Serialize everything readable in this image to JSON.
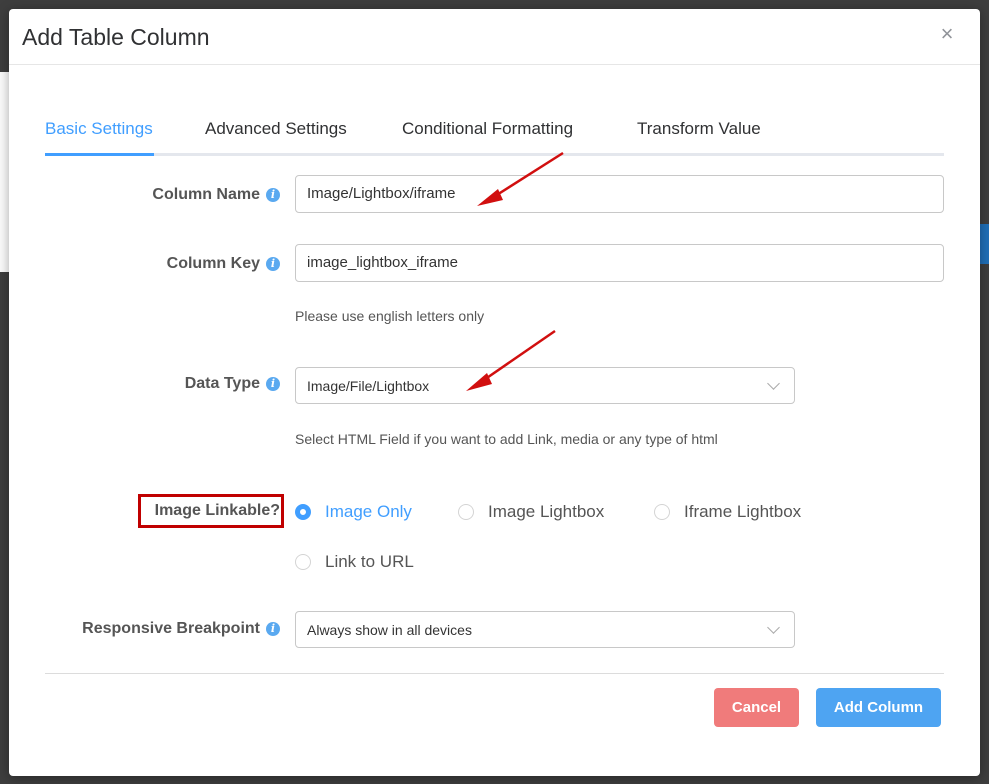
{
  "modal": {
    "title": "Add Table Column",
    "close_symbol": "×"
  },
  "tabs": [
    {
      "label": "Basic Settings",
      "active": true
    },
    {
      "label": "Advanced Settings",
      "active": false
    },
    {
      "label": "Conditional Formatting",
      "active": false
    },
    {
      "label": "Transform Value",
      "active": false
    }
  ],
  "fields": {
    "column_name": {
      "label": "Column Name",
      "value": "Image/Lightbox/iframe"
    },
    "column_key": {
      "label": "Column Key",
      "value": "image_lightbox_iframe",
      "help": "Please use english letters only"
    },
    "data_type": {
      "label": "Data Type",
      "value": "Image/File/Lightbox",
      "help": "Select HTML Field if you want to add Link, media or any type of html"
    },
    "image_linkable": {
      "label": "Image Linkable?",
      "options": [
        "Image Only",
        "Image Lightbox",
        "Iframe Lightbox",
        "Link to URL"
      ],
      "selected": "Image Only"
    },
    "responsive_breakpoint": {
      "label": "Responsive Breakpoint",
      "value": "Always show in all devices"
    }
  },
  "info_icon_glyph": "i",
  "buttons": {
    "cancel": "Cancel",
    "add_column": "Add Column"
  },
  "colors": {
    "accent": "#409eff",
    "cancel": "#f07b7b",
    "add": "#4ea4f2",
    "annotation": "#c00000"
  },
  "icons": {
    "close": "close-icon",
    "info": "info-icon",
    "chevron": "chevron-down-icon",
    "annotation_arrow": "red-arrow-annotation"
  }
}
